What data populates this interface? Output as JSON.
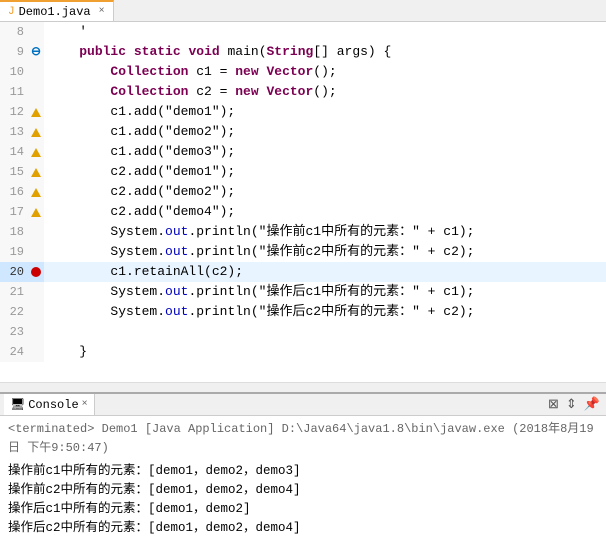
{
  "tab": {
    "label": "Demo1.java",
    "icon": "J",
    "close": "×"
  },
  "editor": {
    "lines": [
      {
        "num": 8,
        "indicator": "",
        "content": "\t'",
        "highlight": false,
        "active": false
      },
      {
        "num": 9,
        "indicator": "arrow",
        "content": "\tpublic static void main(String[] args) {",
        "highlight": false,
        "active": false
      },
      {
        "num": 10,
        "indicator": "",
        "content": "\t\tCollection c1 = new Vector();",
        "highlight": false,
        "active": false
      },
      {
        "num": 11,
        "indicator": "",
        "content": "\t\tCollection c2 = new Vector();",
        "highlight": false,
        "active": false
      },
      {
        "num": 12,
        "indicator": "warn",
        "content": "\t\tc1.add(\"demo1\");",
        "highlight": false,
        "active": false
      },
      {
        "num": 13,
        "indicator": "warn",
        "content": "\t\tc1.add(\"demo2\");",
        "highlight": false,
        "active": false
      },
      {
        "num": 14,
        "indicator": "warn",
        "content": "\t\tc1.add(\"demo3\");",
        "highlight": false,
        "active": false
      },
      {
        "num": 15,
        "indicator": "warn",
        "content": "\t\tc2.add(\"demo1\");",
        "highlight": false,
        "active": false
      },
      {
        "num": 16,
        "indicator": "warn",
        "content": "\t\tc2.add(\"demo2\");",
        "highlight": false,
        "active": false
      },
      {
        "num": 17,
        "indicator": "warn",
        "content": "\t\tc2.add(\"demo4\");",
        "highlight": false,
        "active": false
      },
      {
        "num": 18,
        "indicator": "",
        "content": "\t\tSystem.out.println(\"操作前c1中所有的元素：\" + c1);",
        "highlight": false,
        "active": false
      },
      {
        "num": 19,
        "indicator": "",
        "content": "\t\tSystem.out.println(\"操作前c2中所有的元素：\" + c2);",
        "highlight": false,
        "active": false
      },
      {
        "num": 20,
        "indicator": "bp+arrow",
        "content": "\t\tc1.retainAll(c2);",
        "highlight": true,
        "active": true
      },
      {
        "num": 21,
        "indicator": "",
        "content": "\t\tSystem.out.println(\"操作后c1中所有的元素：\" + c1);",
        "highlight": false,
        "active": false
      },
      {
        "num": 22,
        "indicator": "",
        "content": "\t\tSystem.out.println(\"操作后c2中所有的元素：\" + c2);",
        "highlight": false,
        "active": false
      },
      {
        "num": 23,
        "indicator": "",
        "content": "",
        "highlight": false,
        "active": false
      },
      {
        "num": 24,
        "indicator": "",
        "content": "\t}",
        "highlight": false,
        "active": false
      }
    ]
  },
  "console": {
    "tab_label": "Console",
    "terminated_line": "<terminated> Demo1 [Java Application] D:\\Java64\\java1.8\\bin\\javaw.exe (2018年8月19日 下午9:50:47)",
    "output_lines": [
      "操作前c1中所有的元素：[demo1，demo2，demo3]",
      "操作前c2中所有的元素：[demo1，demo2，demo4]",
      "操作后c1中所有的元素：[demo1，demo2]",
      "操作后c2中所有的元素：[demo1，demo2，demo4]"
    ]
  }
}
